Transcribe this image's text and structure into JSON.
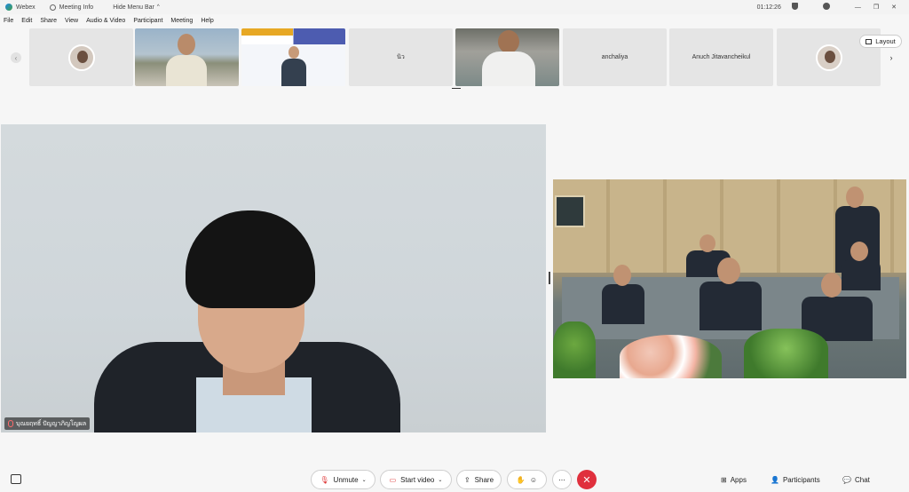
{
  "titlebar": {
    "app": "Webex",
    "meeting_info": "Meeting Info",
    "hide_menu": "Hide Menu Bar",
    "time": "01:12:26"
  },
  "menu": [
    "File",
    "Edit",
    "Share",
    "View",
    "Audio & Video",
    "Participant",
    "Meeting",
    "Help"
  ],
  "filmstrip": {
    "tiles": [
      {
        "type": "avatar",
        "label": ""
      },
      {
        "type": "camera",
        "label": ""
      },
      {
        "type": "camera",
        "label": ""
      },
      {
        "type": "name",
        "label": "นิว"
      },
      {
        "type": "camera",
        "label": ""
      },
      {
        "type": "name",
        "label": "anchaliya"
      },
      {
        "type": "name",
        "label": "Anuch Jitavancheikul"
      },
      {
        "type": "avatar",
        "label": ""
      }
    ]
  },
  "layout_button": "Layout",
  "main_speaker": {
    "name": "บุณยฤทธิ์ ปัญญาภิญโญผล"
  },
  "controls": {
    "unmute": "Unmute",
    "start_video": "Start video",
    "share": "Share",
    "apps": "Apps",
    "participants": "Participants",
    "chat": "Chat"
  },
  "icons": {
    "leave": "close-icon",
    "more": "more-icon",
    "reactions": "reaction-icon"
  }
}
